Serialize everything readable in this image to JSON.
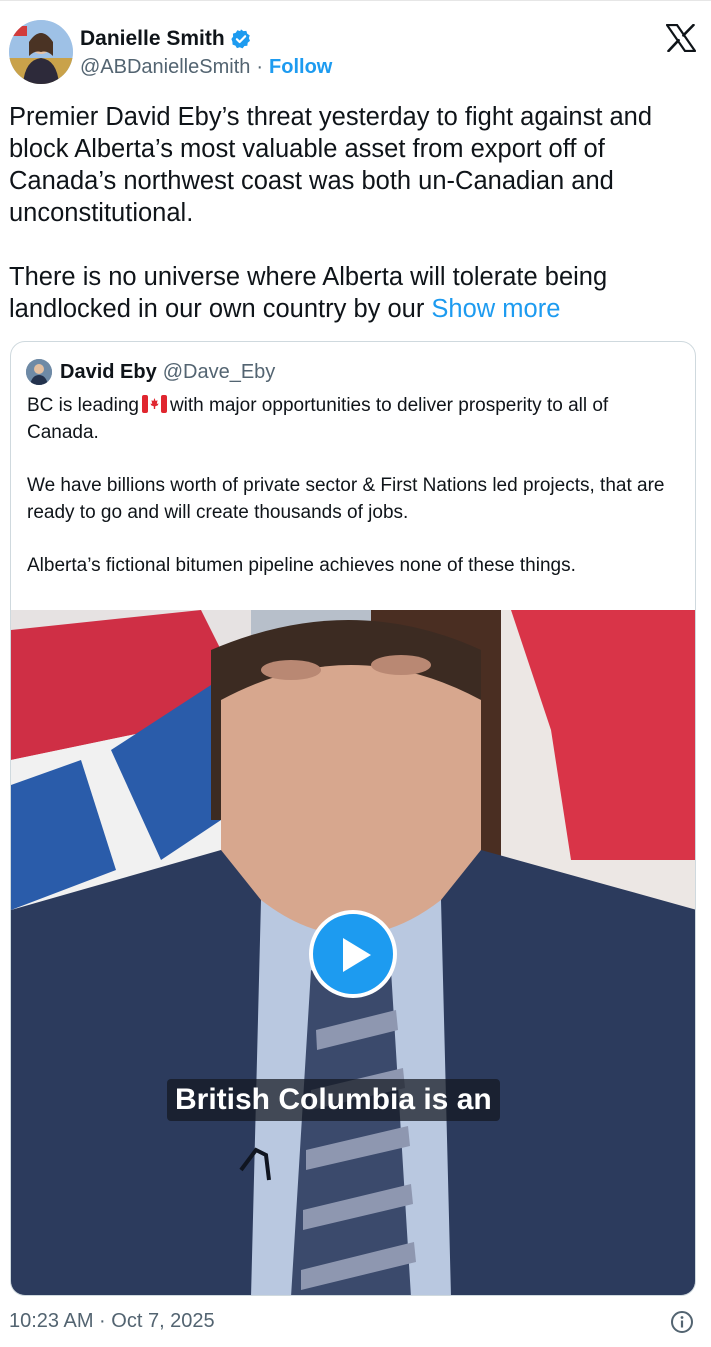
{
  "author": {
    "display_name": "Danielle Smith",
    "handle": "@ABDanielleSmith",
    "separator": "·",
    "follow_label": "Follow",
    "verified": true
  },
  "tweet": {
    "paragraph1": "Premier David Eby’s threat yesterday to fight against and block Alberta’s most valuable asset from export off of Canada’s northwest coast was both un-Canadian and unconstitutional.",
    "paragraph2": "There is no universe where Alberta will tolerate being landlocked in our own country by our",
    "show_more": "Show more"
  },
  "quoted_tweet": {
    "display_name": "David Eby",
    "handle": "@Dave_Eby",
    "line1_before_flag": "BC is leading",
    "line1_after_flag": "with major opportunities to deliver prosperity to all of Canada.",
    "paragraph2": "We have billions worth of private sector & First Nations led projects, that are ready to go and will create thousands of jobs.",
    "paragraph3": "Alberta’s fictional bitumen pipeline achieves none of these things.",
    "video_caption": "British Columbia is an"
  },
  "footer": {
    "timestamp": "10:23 AM · Oct 7, 2025"
  },
  "colors": {
    "accent": "#1d9bf0",
    "text": "#0f1419",
    "secondary_text": "#536471",
    "border": "#cfd9de"
  },
  "icons": [
    "verified-badge-icon",
    "x-logo-icon",
    "play-icon",
    "canada-flag-emoji",
    "info-icon"
  ]
}
